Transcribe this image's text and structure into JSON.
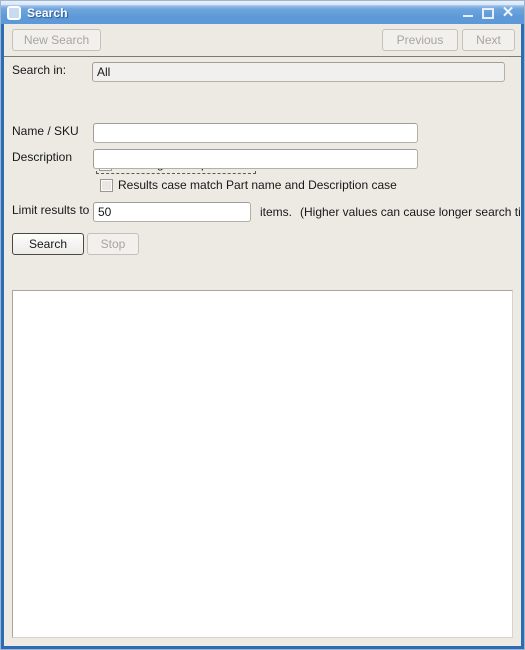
{
  "window": {
    "title": "Search",
    "icon": "app-window-icon",
    "controls": {
      "minimize": "minimize-icon",
      "maximize": "maximize-icon",
      "close": "close-icon",
      "close_glyph": "✕"
    }
  },
  "toolbar": {
    "new_search": "New Search",
    "previous": "Previous",
    "next": "Next"
  },
  "form": {
    "search_in_label": "Search in:",
    "search_in_value": "All",
    "use_regex_label": "Use Regular Expressions",
    "use_regex_checked": false,
    "name_sku_label": "Name / SKU",
    "name_sku_value": "",
    "name_sku_placeholder": "",
    "description_label": "Description",
    "description_value": "",
    "description_placeholder": "",
    "case_match_label": "Results case match Part name and Description case",
    "case_match_checked": false,
    "limit_label": "Limit results to",
    "limit_value": "50",
    "items_label": "items.",
    "limit_hint": "(Higher values can cause longer search times)"
  },
  "actions": {
    "search": "Search",
    "stop": "Stop"
  },
  "results": {
    "content": ""
  },
  "colors": {
    "title_bar": "#5d99d8",
    "frame": "#2b6cb5",
    "form_background": "#edeae3",
    "field_background": "#ffffff",
    "disabled_text": "#a8a5a0",
    "text": "#17181a"
  }
}
